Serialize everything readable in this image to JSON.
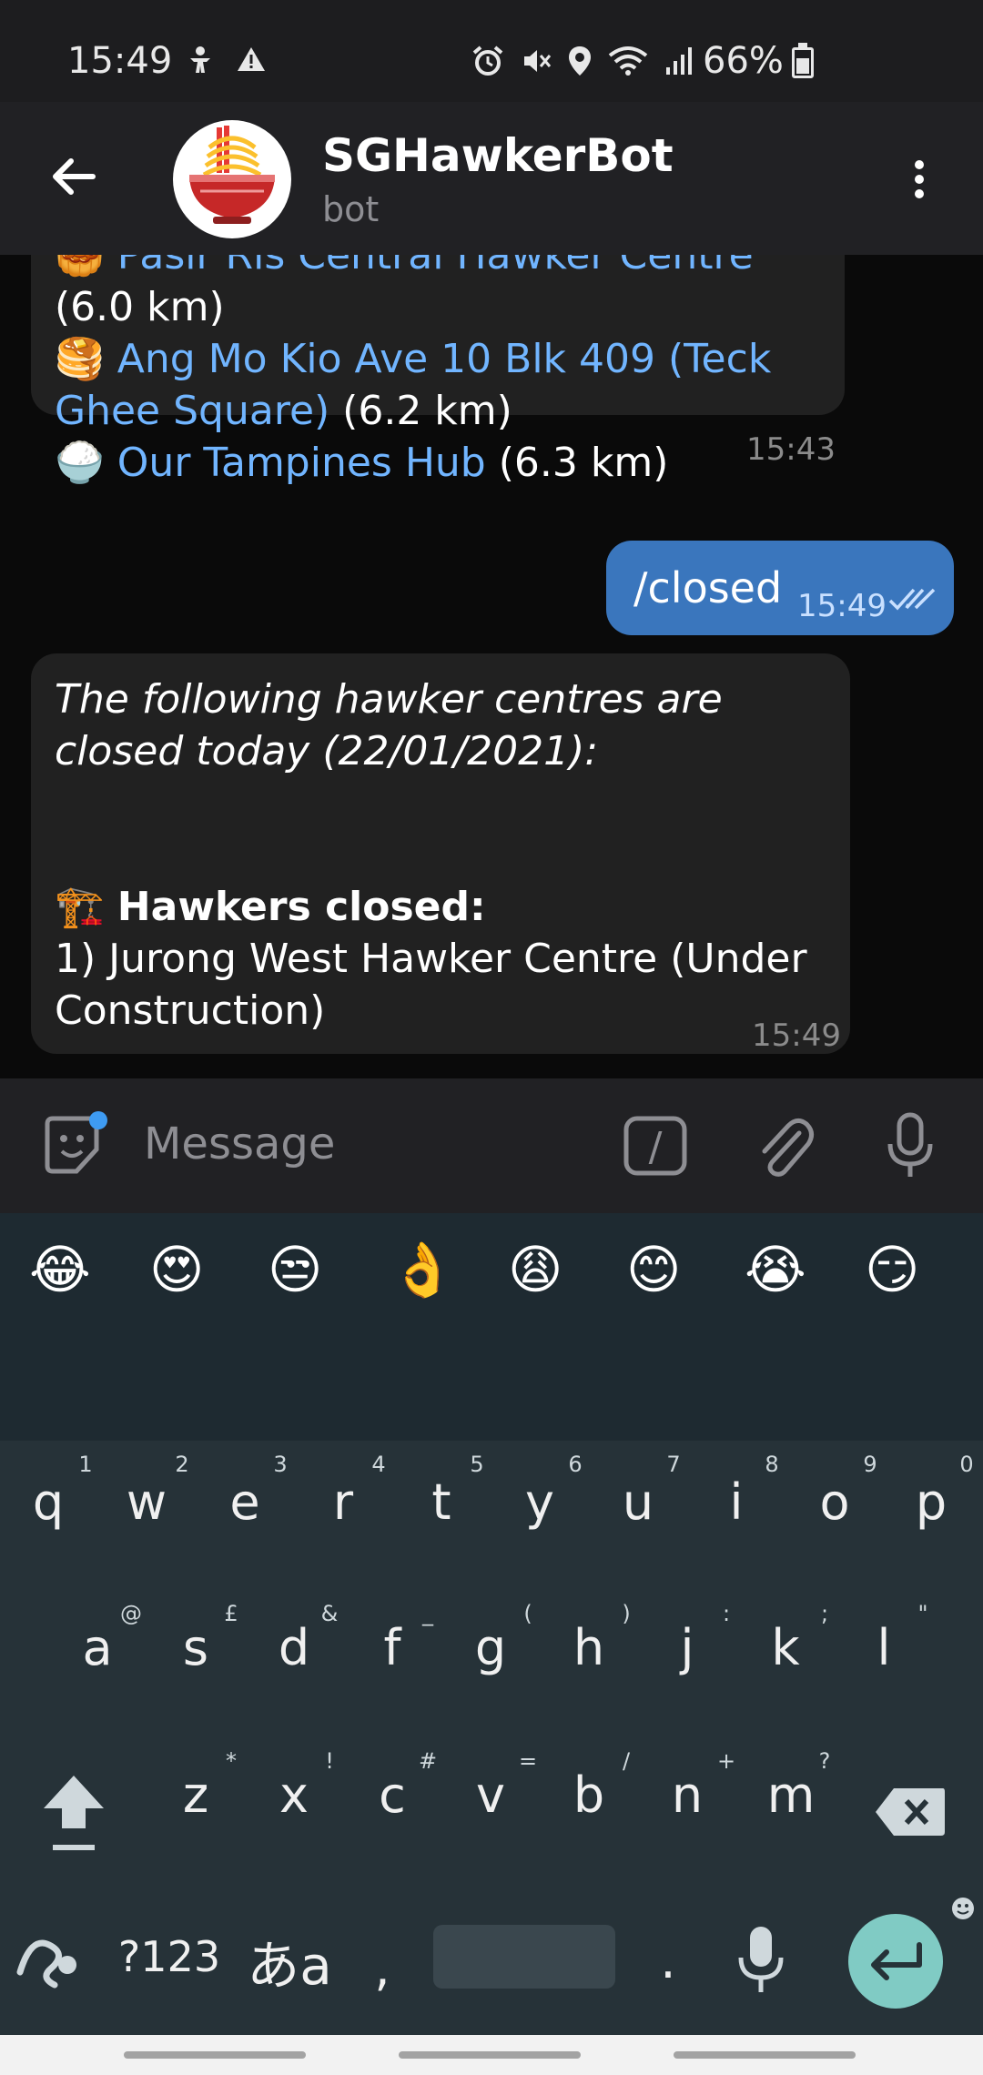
{
  "status_bar": {
    "time": "15:49",
    "battery_pct": "66%",
    "left_icons": [
      "accessibility-icon",
      "warning-icon"
    ],
    "right_icons": [
      "alarm-icon",
      "mute-icon",
      "location-icon",
      "wifi-icon",
      "signal-icon",
      "battery-icon"
    ]
  },
  "header": {
    "title": "SGHawkerBot",
    "subtitle": "bot"
  },
  "messages": [
    {
      "type": "incoming",
      "lines": [
        {
          "emoji": "🥮",
          "link": "Pasir Ris Central Hawker Centre",
          "text": " (6.0 km)"
        },
        {
          "emoji": "🥞",
          "link": "Ang Mo Kio Ave 10 Blk 409 (Teck Ghee Square)",
          "text": " (6.2 km)"
        },
        {
          "emoji": "🍚",
          "link": "Our Tampines Hub",
          "text": " (6.3 km)"
        }
      ],
      "time": "15:43"
    },
    {
      "type": "outgoing",
      "text": "/closed",
      "time": "15:49"
    },
    {
      "type": "incoming",
      "intro": "The following hawker centres are closed today (22/01/2021):",
      "section_emoji": "🏗️",
      "section_title": "Hawkers closed:",
      "item": "1) Jurong West Hawker Centre (Under Construction)",
      "time": "15:49"
    }
  ],
  "input": {
    "placeholder": "Message",
    "command_label": "/"
  },
  "emoji_suggestions": [
    "😂",
    "😍",
    "😒",
    "👌",
    "😩",
    "😊",
    "😭",
    "😏"
  ],
  "keyboard": {
    "numbers": [
      "1",
      "2",
      "3",
      "4",
      "5",
      "6",
      "7",
      "8",
      "9",
      "0"
    ],
    "row1": [
      "q",
      "w",
      "e",
      "r",
      "t",
      "y",
      "u",
      "i",
      "o",
      "p"
    ],
    "row2_hints": [
      "@",
      "£",
      "&",
      "_",
      "(",
      ")",
      ":",
      ";",
      "\""
    ],
    "row2": [
      "a",
      "s",
      "d",
      "f",
      "g",
      "h",
      "j",
      "k",
      "l"
    ],
    "row3_hints": [
      "*",
      "!",
      "#",
      "=",
      "/",
      "+",
      "?"
    ],
    "row3": [
      "z",
      "x",
      "c",
      "v",
      "b",
      "n",
      "m"
    ],
    "symbols_label": "?123",
    "lang_label": "あa",
    "comma": ",",
    "period": "."
  }
}
